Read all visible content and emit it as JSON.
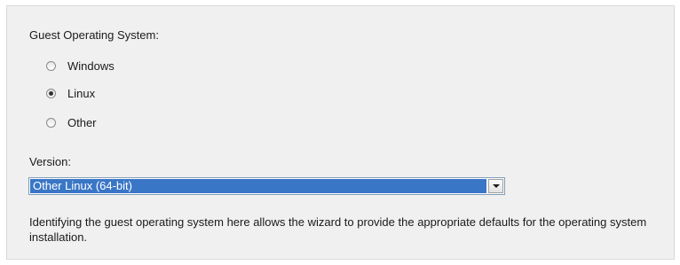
{
  "guest_os": {
    "label": "Guest Operating System:",
    "options": [
      {
        "label": "Windows",
        "selected": false
      },
      {
        "label": "Linux",
        "selected": true
      },
      {
        "label": "Other",
        "selected": false
      }
    ]
  },
  "version": {
    "label": "Version:",
    "selected": "Other Linux (64-bit)",
    "highlight_color": "#3a76c6"
  },
  "description": "Identifying the guest operating system here allows the wizard to provide the appropriate defaults for the operating system installation."
}
